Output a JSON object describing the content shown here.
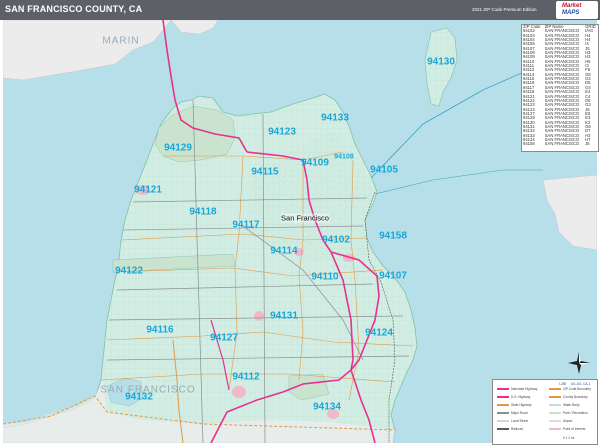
{
  "header": {
    "title": "SAN FRANCISCO COUNTY, CA",
    "edition": "2021 ZIP Code Premium Edition",
    "logo_line1": "Market",
    "logo_line2": "MAPS"
  },
  "colors": {
    "water": "#b7dfe9",
    "land_inside": "#d2ede3",
    "land_outside": "#ececec",
    "zip_label": "#1aa6d8",
    "freeway": "#e8308f",
    "boundary": "#e09a45"
  },
  "map_labels": {
    "marin": "MARIN",
    "san_francisco_south": "SAN FRANCISCO",
    "city": "San Francisco"
  },
  "zips": [
    {
      "code": "94130"
    },
    {
      "code": "94133"
    },
    {
      "code": "94123"
    },
    {
      "code": "94129"
    },
    {
      "code": "94109"
    },
    {
      "code": "94108"
    },
    {
      "code": "94115"
    },
    {
      "code": "94105"
    },
    {
      "code": "94121"
    },
    {
      "code": "94118"
    },
    {
      "code": "94117"
    },
    {
      "code": "94102"
    },
    {
      "code": "94158"
    },
    {
      "code": "94114"
    },
    {
      "code": "94122"
    },
    {
      "code": "94110"
    },
    {
      "code": "94107"
    },
    {
      "code": "94116"
    },
    {
      "code": "94131"
    },
    {
      "code": "94127"
    },
    {
      "code": "94124"
    },
    {
      "code": "94112"
    },
    {
      "code": "94132"
    },
    {
      "code": "94134"
    }
  ],
  "zip_table": {
    "headers": [
      "ZIP Code",
      "ZIP Name",
      "GRID"
    ],
    "rows": [
      [
        "94102",
        "SAN FRANCISCO",
        "I/H4"
      ],
      [
        "94103",
        "SAN FRANCISCO",
        "H4"
      ],
      [
        "94104",
        "SAN FRANCISCO",
        "H4"
      ],
      [
        "94105",
        "SAN FRANCISCO",
        "I4"
      ],
      [
        "94107",
        "SAN FRANCISCO",
        "J5"
      ],
      [
        "94108",
        "SAN FRANCISCO",
        "H3"
      ],
      [
        "94109",
        "SAN FRANCISCO",
        "H3"
      ],
      [
        "94110",
        "SAN FRANCISCO",
        "H5"
      ],
      [
        "94111",
        "SAN FRANCISCO",
        "I3"
      ],
      [
        "94112",
        "SAN FRANCISCO",
        "F6"
      ],
      [
        "94114",
        "SAN FRANCISCO",
        "G5"
      ],
      [
        "94115",
        "SAN FRANCISCO",
        "G4"
      ],
      [
        "94116",
        "SAN FRANCISCO",
        "D5"
      ],
      [
        "94117",
        "SAN FRANCISCO",
        "G4"
      ],
      [
        "94118",
        "SAN FRANCISCO",
        "E4"
      ],
      [
        "94121",
        "SAN FRANCISCO",
        "C4"
      ],
      [
        "94122",
        "SAN FRANCISCO",
        "D5"
      ],
      [
        "94123",
        "SAN FRANCISCO",
        "G3"
      ],
      [
        "94124",
        "SAN FRANCISCO",
        "J6"
      ],
      [
        "94127",
        "SAN FRANCISCO",
        "E6"
      ],
      [
        "94129",
        "SAN FRANCISCO",
        "E3"
      ],
      [
        "94130",
        "SAN FRANCISCO",
        "K2"
      ],
      [
        "94131",
        "SAN FRANCISCO",
        "G6"
      ],
      [
        "94132",
        "SAN FRANCISCO",
        "D7"
      ],
      [
        "94133",
        "SAN FRANCISCO",
        "H3"
      ],
      [
        "94134",
        "SAN FRANCISCO",
        "H7"
      ],
      [
        "94158",
        "SAN FRANCISCO",
        "J5"
      ]
    ]
  },
  "legend": {
    "rows": [
      "Interstate Highway",
      "U.S. Highway",
      "State Highway",
      "Major Road",
      "Local Street",
      "Railroad",
      "ZIP Code Boundary",
      "County Boundary",
      "Water Body",
      "Park / Recreation",
      "Airport",
      "Point of Interest"
    ],
    "highway_shields": [
      "I-280",
      "US-101",
      "CA-1"
    ],
    "scale": "0 1 2 mi"
  }
}
